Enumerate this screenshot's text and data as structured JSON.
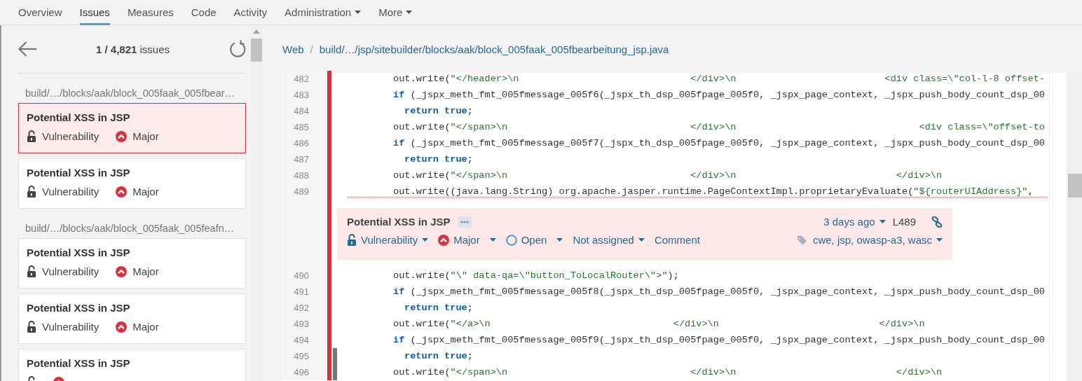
{
  "nav": {
    "tabs": [
      {
        "label": "Overview",
        "selected": false,
        "dropdown": false
      },
      {
        "label": "Issues",
        "selected": true,
        "dropdown": false
      },
      {
        "label": "Measures",
        "selected": false,
        "dropdown": false
      },
      {
        "label": "Code",
        "selected": false,
        "dropdown": false
      },
      {
        "label": "Activity",
        "selected": false,
        "dropdown": false
      },
      {
        "label": "Administration",
        "selected": false,
        "dropdown": true
      },
      {
        "label": "More",
        "selected": false,
        "dropdown": true
      }
    ]
  },
  "issues_panel": {
    "counter": "**1 / 4,821** issues",
    "groups": [
      {
        "path": "build/…/blocks/aak/block_005faak_005fbear…",
        "issues": [
          {
            "title": "Potential XSS in JSP",
            "type": "Vulnerability",
            "severity": "Major",
            "selected": true
          },
          {
            "title": "Potential XSS in JSP",
            "type": "Vulnerability",
            "severity": "Major",
            "selected": false
          }
        ]
      },
      {
        "path": "build/…/blocks/aak/block_005faak_005feafn…",
        "issues": [
          {
            "title": "Potential XSS in JSP",
            "type": "Vulnerability",
            "severity": "Major",
            "selected": false
          },
          {
            "title": "Potential XSS in JSP",
            "type": "Vulnerability",
            "severity": "Major",
            "selected": false
          },
          {
            "title": "Potential XSS in JSP",
            "selected": false
          }
        ]
      }
    ]
  },
  "breadcrumb": {
    "project": "Web",
    "separator": "/",
    "path": "build/…/jsp/sitebuilder/blocks/aak/block_005faak_005fbearbeitung_jsp.java"
  },
  "code": {
    "lines": [
      {
        "kind": "code",
        "number": "482",
        "flagged": true,
        "secondary": false,
        "squiggle": false,
        "tokens": [
          {
            "kind": "plain",
            "text": "out.write("
          },
          {
            "kind": "string",
            "text": "\"</header>\\n                              </div>\\n                          <div class=\\\"col-l-8 offset-"
          }
        ]
      },
      {
        "kind": "code",
        "number": "483",
        "flagged": true,
        "secondary": false,
        "squiggle": false,
        "tokens": [
          {
            "kind": "keyword",
            "text": "if"
          },
          {
            "kind": "plain",
            "text": " (_jspx_meth_fmt_005fmessage_005f6(_jspx_th_dsp_005fpage_005f0, _jspx_page_context, _jspx_push_body_count_dsp_00"
          }
        ]
      },
      {
        "kind": "nested",
        "number": "484",
        "flagged": true,
        "secondary": false,
        "squiggle": false,
        "tokens": [
          {
            "kind": "keyword",
            "text": "return true"
          },
          {
            "kind": "plain",
            "text": ";"
          }
        ]
      },
      {
        "kind": "code",
        "number": "485",
        "flagged": true,
        "secondary": false,
        "squiggle": false,
        "tokens": [
          {
            "kind": "plain",
            "text": "out.write("
          },
          {
            "kind": "string",
            "text": "\"</span>\\n                                </div>\\n                                <div class=\\\"offset-to"
          }
        ]
      },
      {
        "kind": "code",
        "number": "486",
        "flagged": true,
        "secondary": false,
        "squiggle": false,
        "tokens": [
          {
            "kind": "keyword",
            "text": "if"
          },
          {
            "kind": "plain",
            "text": " (_jspx_meth_fmt_005fmessage_005f7(_jspx_th_dsp_005fpage_005f0, _jspx_page_context, _jspx_push_body_count_dsp_00"
          }
        ]
      },
      {
        "kind": "nested",
        "number": "487",
        "flagged": true,
        "secondary": false,
        "squiggle": false,
        "tokens": [
          {
            "kind": "keyword",
            "text": "return true"
          },
          {
            "kind": "plain",
            "text": ";"
          }
        ]
      },
      {
        "kind": "code",
        "number": "488",
        "flagged": true,
        "secondary": false,
        "squiggle": false,
        "tokens": [
          {
            "kind": "plain",
            "text": "out.write("
          },
          {
            "kind": "string",
            "text": "\"</span>\\n                                </div>\\n                            </div>\\n"
          }
        ]
      },
      {
        "kind": "code",
        "number": "489",
        "flagged": true,
        "secondary": false,
        "squiggle": true,
        "tokens": [
          {
            "kind": "plain",
            "text": "out.write((java.lang.String) org.apache.jasper.runtime.PageContextImpl.proprietaryEvaluate("
          },
          {
            "kind": "string",
            "text": "\"${routerUIAddress}\""
          },
          {
            "kind": "plain",
            "text": ","
          }
        ]
      },
      {
        "kind": "issue",
        "flagged": true,
        "title": "Potential XSS in JSP",
        "age": "3 days ago",
        "line": "L489",
        "actions": [
          {
            "kind": "type",
            "label": "Vulnerability",
            "dropdown": true
          },
          {
            "kind": "severity",
            "label": "Major",
            "dropdown": true
          },
          {
            "kind": "status",
            "label": "Open",
            "dropdown": true
          },
          {
            "kind": "assignee",
            "label": "Not assigned",
            "dropdown": true
          },
          {
            "kind": "comment",
            "label": "Comment",
            "dropdown": false
          }
        ],
        "tags": "cwe, jsp, owasp-a3, wasc"
      },
      {
        "kind": "code",
        "number": "490",
        "flagged": true,
        "secondary": false,
        "squiggle": false,
        "tokens": [
          {
            "kind": "plain",
            "text": "out.write("
          },
          {
            "kind": "string",
            "text": "\"\\\" data-qa=\\\"button_ToLocalRouter\\\">\""
          },
          {
            "kind": "plain",
            "text": ");"
          }
        ]
      },
      {
        "kind": "code",
        "number": "491",
        "flagged": true,
        "secondary": false,
        "squiggle": false,
        "tokens": [
          {
            "kind": "keyword",
            "text": "if"
          },
          {
            "kind": "plain",
            "text": " (_jspx_meth_fmt_005fmessage_005f8(_jspx_th_dsp_005fpage_005f0, _jspx_page_context, _jspx_push_body_count_dsp_00"
          }
        ]
      },
      {
        "kind": "nested",
        "number": "492",
        "flagged": true,
        "secondary": false,
        "squiggle": false,
        "tokens": [
          {
            "kind": "keyword",
            "text": "return true"
          },
          {
            "kind": "plain",
            "text": ";"
          }
        ]
      },
      {
        "kind": "code",
        "number": "493",
        "flagged": true,
        "secondary": false,
        "squiggle": false,
        "tokens": [
          {
            "kind": "plain",
            "text": "out.write("
          },
          {
            "kind": "string",
            "text": "\"</a>\\n                                </div>\\n                            </div>\\n"
          }
        ]
      },
      {
        "kind": "code",
        "number": "494",
        "flagged": true,
        "secondary": false,
        "squiggle": false,
        "tokens": [
          {
            "kind": "keyword",
            "text": "if"
          },
          {
            "kind": "plain",
            "text": " (_jspx_meth_fmt_005fmessage_005f9(_jspx_th_dsp_005fpage_005f0, _jspx_page_context, _jspx_push_body_count_dsp_00"
          }
        ]
      },
      {
        "kind": "nested",
        "number": "495",
        "flagged": true,
        "secondary": true,
        "squiggle": false,
        "tokens": [
          {
            "kind": "keyword",
            "text": "return true"
          },
          {
            "kind": "plain",
            "text": ";"
          }
        ]
      },
      {
        "kind": "code",
        "number": "496",
        "flagged": true,
        "secondary": true,
        "squiggle": false,
        "tokens": [
          {
            "kind": "plain",
            "text": "out.write("
          },
          {
            "kind": "string",
            "text": "\"</span>\\n                                </div>\\n                            </div>\\n"
          }
        ]
      }
    ]
  }
}
